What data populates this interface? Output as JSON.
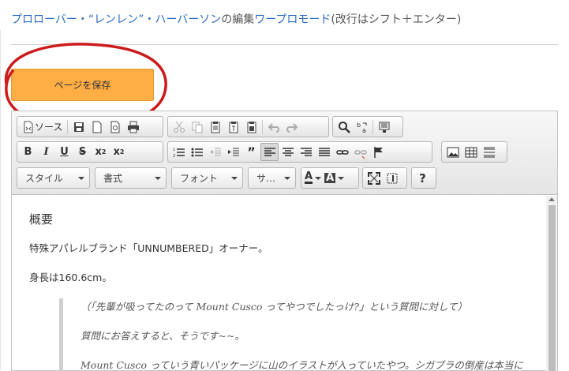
{
  "header": {
    "title_link": "プロローバー・“レンレン”・ハーバーソン",
    "title_mid": "の編集",
    "mode_link": "ワープロモード",
    "hint": "(改行はシフト＋エンター)"
  },
  "save_button": "ページを保存",
  "toolbar": {
    "source": "ソース",
    "style_combo": "スタイル",
    "format_combo": "書式",
    "font_combo": "フォント",
    "size_combo": "サ…",
    "text_color": "A",
    "bg_color": "A",
    "help": "?"
  },
  "content": {
    "heading": "概要",
    "para1": "特殊アパレルブランド「UNNUMBERED」オーナー。",
    "para2": "身長は160.6cm。",
    "quote1": "（「先輩が吸ってたのって Mount Cusco ってやつでしたっけ?」という質問に対して）",
    "quote2": "質問にお答えすると、そうです~~。",
    "quote3": "Mount Cusco っていう青いパッケージに山のイラストが入っていたやつ。シガブラの倒産は本当に"
  },
  "colors": {
    "accent": "#2a6bc5",
    "save_button": "#ffad45",
    "annotation": "#cc1b1b"
  }
}
